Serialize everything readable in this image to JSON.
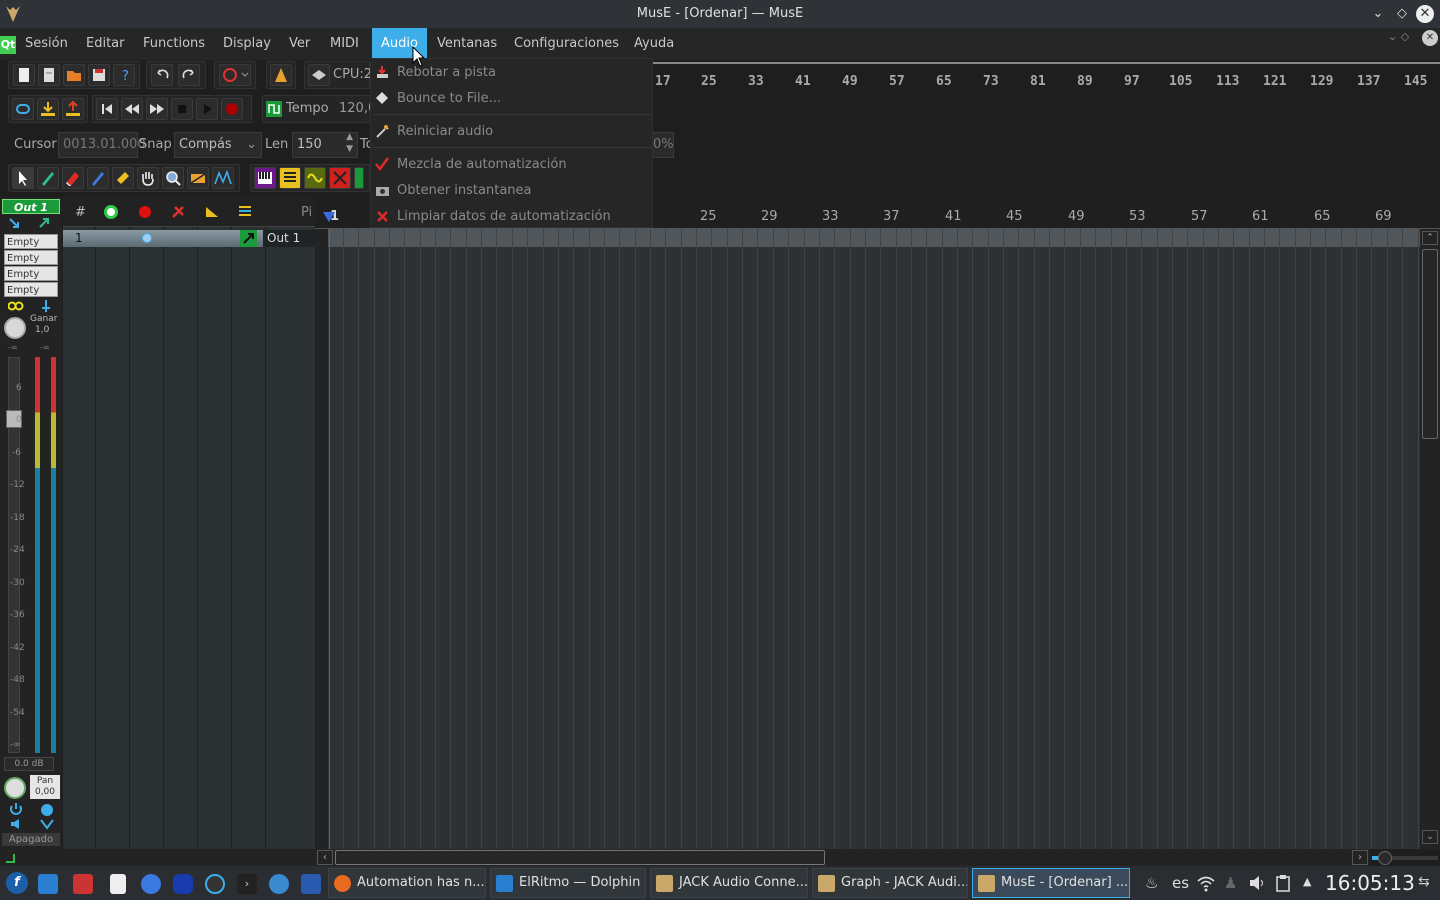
{
  "window": {
    "title": "MusE - [Ordenar] — MusE"
  },
  "menubar": {
    "items": [
      "Sesión",
      "Editar",
      "Functions",
      "Display",
      "Ver",
      "MIDI",
      "Audio",
      "Ventanas",
      "Configuraciones",
      "Ayuda"
    ],
    "active": "Audio"
  },
  "audio_menu": {
    "items": [
      {
        "label": "Rebotar a pista",
        "icon": "bounce-track-icon"
      },
      {
        "label": "Bounce to File...",
        "icon": "bounce-file-icon"
      },
      {
        "label": "Reiniciar audio",
        "icon": "restart-audio-icon"
      },
      {
        "label": "Mezcla de automatización",
        "icon": "automation-mix-icon"
      },
      {
        "label": "Obtener instantanea",
        "icon": "snapshot-icon"
      },
      {
        "label": "Limpiar datos de automatización",
        "icon": "clear-automation-icon"
      }
    ]
  },
  "toolbar": {
    "cpu_label": "CPU:2,",
    "tempo_label": "Tempo",
    "tempo_value": "120,0",
    "cursor_label": "Cursor",
    "cursor_value": "0013.01.000",
    "snap_label": "Snap",
    "snap_value": "Compás",
    "len_label": "Len",
    "len_value": "150",
    "to_label": "To",
    "pct_label": "0%"
  },
  "top_ruler": {
    "numbers": [
      "17",
      "25",
      "33",
      "41",
      "49",
      "57",
      "65",
      "73",
      "81",
      "89",
      "97",
      "105",
      "113",
      "121",
      "129",
      "137",
      "145"
    ]
  },
  "arranger_ruler": {
    "numbers": [
      "1",
      "25",
      "29",
      "33",
      "37",
      "41",
      "45",
      "49",
      "53",
      "57",
      "61",
      "65",
      "69"
    ]
  },
  "strip": {
    "name": "Out 1",
    "slots": [
      "Empty",
      "Empty",
      "Empty",
      "Empty"
    ],
    "gain_label": "Ganar",
    "gain_value": "1,0",
    "meter_top": [
      "-∞",
      "-∞"
    ],
    "scale": [
      "6",
      "0",
      "-6",
      "-12",
      "-18",
      "-24",
      "-30",
      "-36",
      "-42",
      "-48",
      "-54",
      "-∞"
    ],
    "db_value": "0.0 dB",
    "pan_label": "Pan",
    "pan_value": "0,00",
    "off_label": "Apagado"
  },
  "tracklist": {
    "header_num": "#",
    "header_port": "Pi",
    "track": {
      "num": "1",
      "name": "Out 1"
    }
  },
  "taskbar": {
    "tasks": [
      {
        "label": "Automation has n...",
        "icon": "firefox-icon"
      },
      {
        "label": "ElRitmo — Dolphin",
        "icon": "dolphin-icon"
      },
      {
        "label": "JACK Audio Conne...",
        "icon": "jack-icon"
      },
      {
        "label": "Graph - JACK Audi...",
        "icon": "jack-graph-icon"
      },
      {
        "label": "MusE - [Ordenar] ...",
        "icon": "muse-icon"
      }
    ],
    "lang": "es",
    "clock": "16:05:13"
  },
  "colors": {
    "accent": "#3daee9",
    "playhead": "#e03030",
    "record": "#e01010"
  }
}
